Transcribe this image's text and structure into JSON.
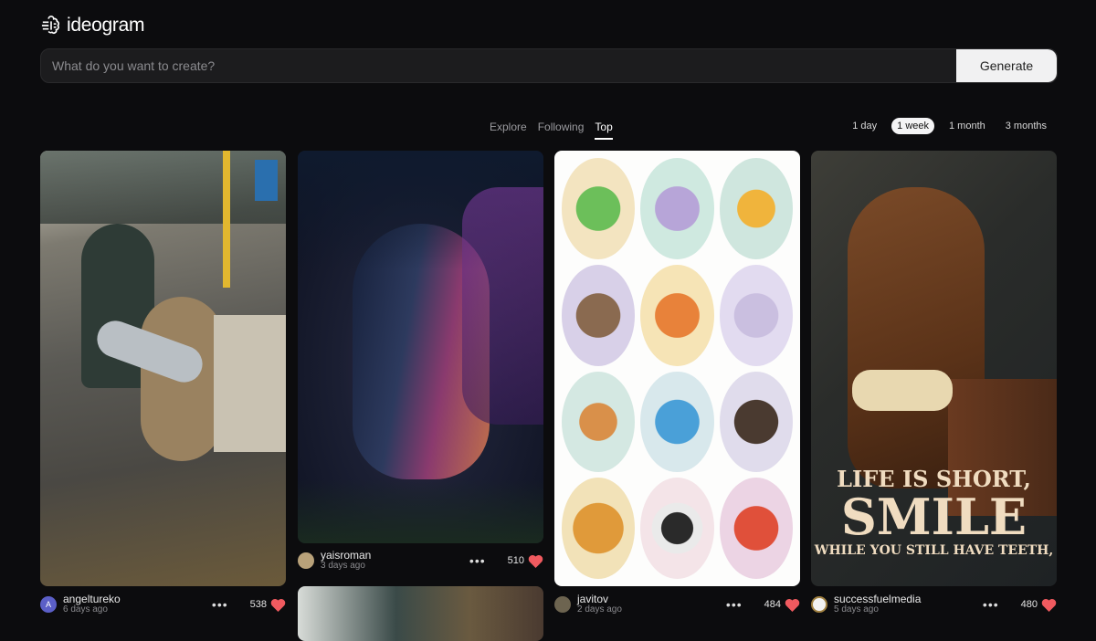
{
  "app": {
    "name": "ideogram"
  },
  "prompt": {
    "placeholder": "What do you want to create?",
    "value": "",
    "generate_label": "Generate"
  },
  "tabs": [
    {
      "label": "Explore"
    },
    {
      "label": "Following"
    },
    {
      "label": "Top",
      "active": true
    }
  ],
  "ranges": [
    {
      "label": "1 day"
    },
    {
      "label": "1 week",
      "active": true
    },
    {
      "label": "1 month"
    },
    {
      "label": "3 months"
    }
  ],
  "posts": [
    {
      "user": "angeltureko",
      "avatar_letter": "A",
      "avatar_color": "#5b5fc7",
      "when": "6 days ago",
      "likes": "538",
      "image": "cat carrying fish running from fishmonger in market"
    },
    {
      "user": "yaisroman",
      "avatar_letter": "",
      "avatar_color": "#b9a27a",
      "when": "3 days ago",
      "likes": "510",
      "image": "woman portrait with dark forest galaxy face paint"
    },
    {
      "user": "javitov",
      "avatar_letter": "",
      "avatar_color": "#6d6450",
      "when": "2 days ago",
      "likes": "484",
      "image": "grid of cartoon baby animal stickers"
    },
    {
      "user": "successfuelmedia",
      "avatar_letter": "",
      "avatar_color": "#f2f2f2",
      "when": "5 days ago",
      "likes": "480",
      "image": "grinning horse poster",
      "poster_lines": [
        "LIFE IS SHORT,",
        "SMILE",
        "WHILE YOU STILL HAVE TEETH,"
      ]
    }
  ],
  "icons": {
    "logo": "brain-icon",
    "more": "ellipsis-icon",
    "like": "heart-icon"
  },
  "colors": {
    "heart": "#f05a5f",
    "background": "#0c0c0e"
  }
}
